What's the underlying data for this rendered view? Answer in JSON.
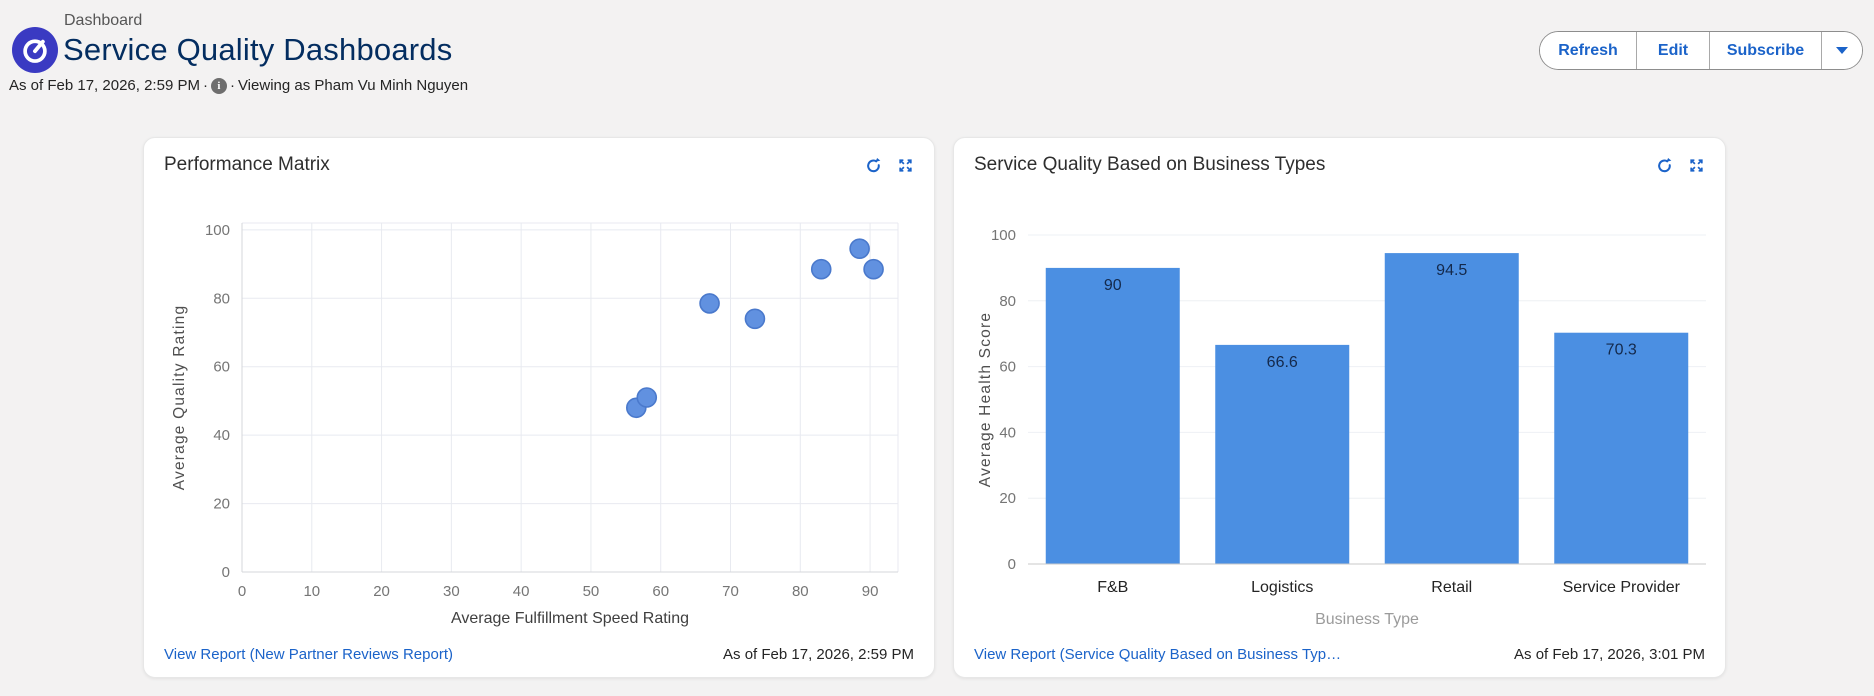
{
  "header": {
    "breadcrumb": "Dashboard",
    "title": "Service Quality Dashboards",
    "as_of": "As of Feb 17, 2026, 2:59 PM",
    "dot": "·",
    "info_glyph": "i",
    "viewing_as": "Viewing as Pham Vu Minh Nguyen",
    "buttons": {
      "refresh": "Refresh",
      "edit": "Edit",
      "subscribe": "Subscribe"
    },
    "accent_color": "#1b63c9",
    "logo_color": "#3a3ac2"
  },
  "left_card": {
    "title": "Performance Matrix",
    "footer_link": "View Report (New Partner Reviews Report)",
    "footer_timestamp": "As of Feb 17, 2026, 2:59 PM"
  },
  "right_card": {
    "title": "Service Quality Based on Business Types",
    "footer_link": "View Report (Service Quality Based on Business Typ…",
    "footer_timestamp": "As of Feb 17, 2026, 3:01 PM"
  },
  "chart_data": [
    {
      "type": "scatter",
      "title": "Performance Matrix",
      "xlabel": "Average Fulfillment Speed Rating",
      "ylabel": "Average Quality Rating",
      "xlim": [
        0,
        94
      ],
      "ylim": [
        0,
        102
      ],
      "xticks": [
        0,
        10,
        20,
        30,
        40,
        50,
        60,
        70,
        80,
        90
      ],
      "yticks": [
        0,
        20,
        40,
        60,
        80,
        100
      ],
      "grid": true,
      "legend": "none",
      "points": [
        [
          56.5,
          48
        ],
        [
          58,
          51
        ],
        [
          67,
          78.5
        ],
        [
          73.5,
          74
        ],
        [
          83,
          88.5
        ],
        [
          88.5,
          94.5
        ],
        [
          90.5,
          88.5
        ]
      ],
      "point_color": "#6191e0",
      "point_border": "#4a79cc"
    },
    {
      "type": "bar",
      "title": "Service Quality Based on Business Types",
      "xlabel": "Business Type",
      "ylabel": "Average Health Score",
      "ylim": [
        0,
        100
      ],
      "yticks": [
        0,
        20,
        40,
        60,
        80,
        100
      ],
      "grid": true,
      "legend": "none",
      "categories": [
        "F&B",
        "Logistics",
        "Retail",
        "Service Provider"
      ],
      "values": [
        90,
        66.6,
        94.5,
        70.3
      ],
      "value_labels": [
        "90",
        "66.6",
        "94.5",
        "70.3"
      ],
      "bar_color": "#4b8fe2",
      "value_label_color": "#14294b"
    }
  ]
}
